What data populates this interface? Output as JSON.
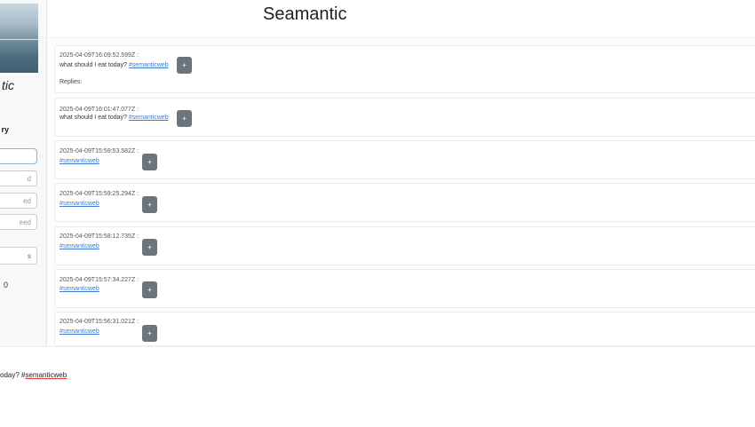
{
  "app": {
    "title": "Seamantic"
  },
  "sidebar": {
    "title_fragment": "tic",
    "label_fragment": "ry",
    "fields": [
      "",
      "d",
      "ed",
      "eed"
    ],
    "button_fragment": "s",
    "count": "0"
  },
  "posts": [
    {
      "timestamp": "2025-04-09T16:09:52.599Z :",
      "text": "what should I eat today? ",
      "hashtag": "#semanticweb",
      "button": "+",
      "replies_label": "Replies:"
    },
    {
      "timestamp": "2025-04-09T16:01:47.077Z :",
      "text": "what should I eat today? ",
      "hashtag": "#semanticweb",
      "button": "+"
    },
    {
      "timestamp": "2025-04-09T15:59:53.582Z :",
      "text": "",
      "hashtag": "#semanticweb",
      "button": "+"
    },
    {
      "timestamp": "2025-04-09T15:59:25.294Z :",
      "text": "",
      "hashtag": "#semanticweb",
      "button": "+"
    },
    {
      "timestamp": "2025-04-09T15:58:12.735Z :",
      "text": "",
      "hashtag": "#semanticweb",
      "button": "+"
    },
    {
      "timestamp": "2025-04-09T15:57:34.227Z :",
      "text": "",
      "hashtag": "#semanticweb",
      "button": "+"
    },
    {
      "timestamp": "2025-04-09T15:56:31.021Z :",
      "text": "",
      "hashtag": "#semanticweb",
      "button": "+"
    }
  ],
  "compose": {
    "text": "oday? #",
    "hashtag": "semanticweb"
  }
}
